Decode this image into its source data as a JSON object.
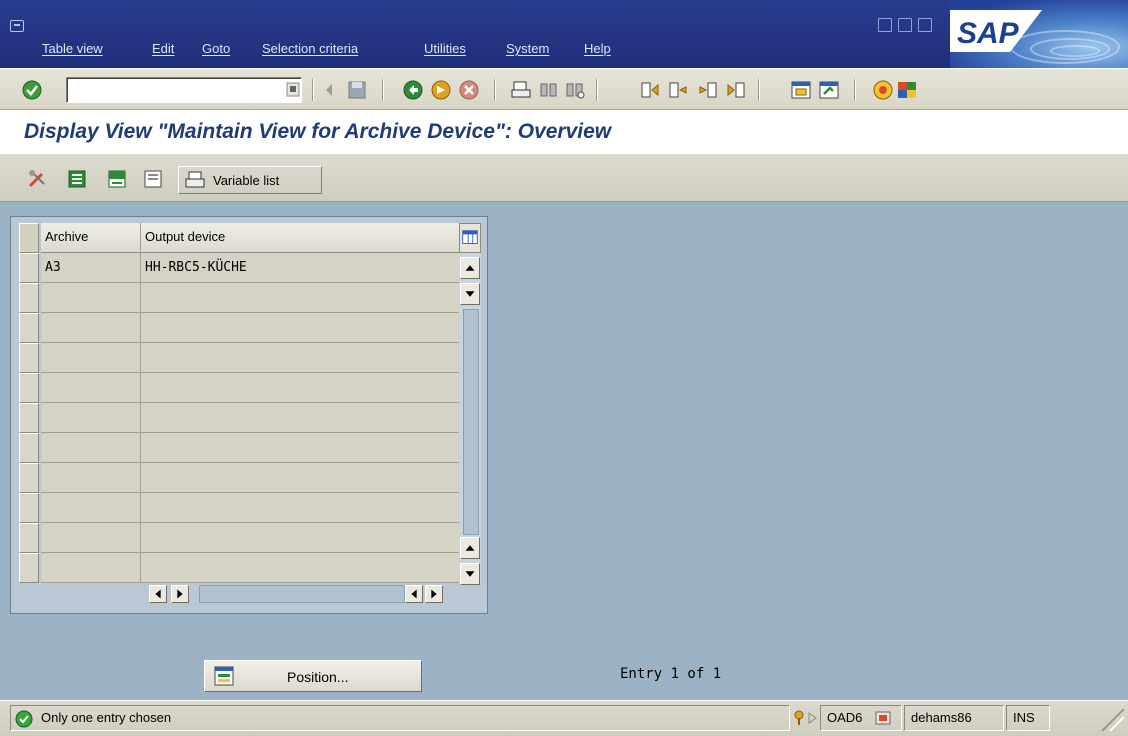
{
  "menubar": {
    "items": [
      {
        "label": "Table view"
      },
      {
        "label": "Edit"
      },
      {
        "label": "Goto"
      },
      {
        "label": "Selection criteria"
      },
      {
        "label": "Utilities"
      },
      {
        "label": "System"
      },
      {
        "label": "Help"
      }
    ],
    "logo_text": "SAP",
    "colors": {
      "menu_bg": "#1e2f7a",
      "menu_text": "#dfe6ff"
    }
  },
  "standard_toolbar": {
    "command_field_value": "",
    "icons": [
      "enter-check-icon",
      "save-icon",
      "back-icon",
      "exit-icon",
      "cancel-icon",
      "print-icon",
      "find-icon",
      "find-next-icon",
      "first-page-icon",
      "previous-page-icon",
      "next-page-icon",
      "last-page-icon",
      "create-session-icon",
      "shortcut-icon",
      "help-icon",
      "layout-menu-icon"
    ]
  },
  "screen": {
    "title": "Display View \"Maintain View for Archive Device\": Overview",
    "title_color": "#1f3b7a"
  },
  "app_toolbar": {
    "icons": [
      "display-change-icon",
      "select-all-icon",
      "select-block-icon",
      "deselect-all-icon"
    ],
    "variable_list_label": "Variable list"
  },
  "table": {
    "columns": [
      "Archive",
      "Output device"
    ],
    "rows": [
      {
        "archive": "A3",
        "output_device": "HH-RBC5-KÜCHE"
      },
      {
        "archive": "",
        "output_device": ""
      },
      {
        "archive": "",
        "output_device": ""
      },
      {
        "archive": "",
        "output_device": ""
      },
      {
        "archive": "",
        "output_device": ""
      },
      {
        "archive": "",
        "output_device": ""
      },
      {
        "archive": "",
        "output_device": ""
      },
      {
        "archive": "",
        "output_device": ""
      },
      {
        "archive": "",
        "output_device": ""
      },
      {
        "archive": "",
        "output_device": ""
      },
      {
        "archive": "",
        "output_device": ""
      }
    ]
  },
  "footer": {
    "position_button_label": "Position...",
    "entry_info": "Entry 1 of 1"
  },
  "statusbar": {
    "message": "Only one entry chosen",
    "system": "OAD6",
    "server": "dehams86",
    "mode": "INS",
    "colors": {
      "ok_green": "#3aa63a"
    }
  }
}
